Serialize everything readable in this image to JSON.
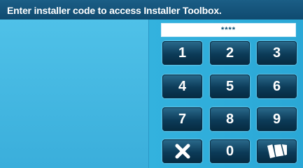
{
  "header": {
    "title": "Enter installer code to access Installer Toolbox."
  },
  "code_field": {
    "value": "****"
  },
  "keypad": {
    "keys": [
      "1",
      "2",
      "3",
      "4",
      "5",
      "6",
      "7",
      "8",
      "9",
      "0"
    ]
  },
  "colors": {
    "header_bg": "#0f4a6f",
    "panel_bg": "#3aaedb",
    "key_bg": "#0c3b58"
  },
  "icons": {
    "clear": "close-icon",
    "enter": "flag-icon"
  }
}
